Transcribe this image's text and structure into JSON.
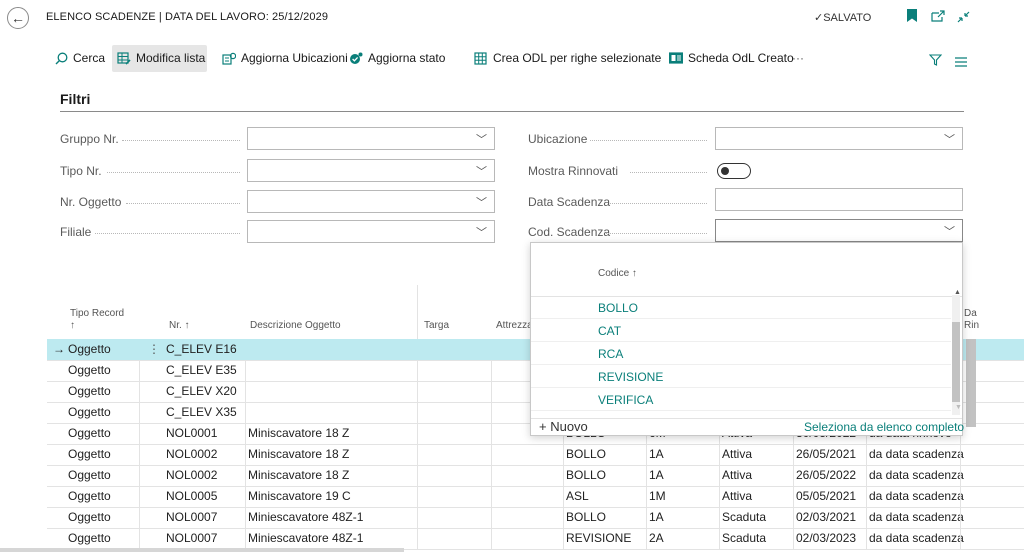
{
  "header": {
    "back_glyph": "←",
    "title": "ELENCO SCADENZE | DATA DEL LAVORO: 25/12/2029",
    "saved": "✓SALVATO"
  },
  "toolbar": {
    "search": "Cerca",
    "edit_list": "Modifica lista",
    "update_locations": "Aggiorna Ubicazioni",
    "update_status": "Aggiorna stato",
    "create_odl": "Crea ODL per righe selezionate",
    "odl_card": "Scheda OdL Creato",
    "more": "···"
  },
  "filters": {
    "heading": "Filtri",
    "gruppo_nr": "Gruppo Nr.",
    "tipo_nr": "Tipo Nr.",
    "nr_oggetto": "Nr. Oggetto",
    "filiale": "Filiale",
    "ubicazione": "Ubicazione",
    "mostra_rinnovati": "Mostra Rinnovati",
    "data_scadenza": "Data Scadenza",
    "cod_scadenza": "Cod. Scadenza"
  },
  "table": {
    "headers": {
      "tipo_record": "Tipo Record",
      "tipo_record_sort": "↑",
      "nr": "Nr. ↑",
      "descrizione": "Descrizione Oggetto",
      "targa": "Targa",
      "attrezza": "Attrezza",
      "da": "Da",
      "rin": "Rin"
    },
    "selected_arrow": "→",
    "rows": [
      {
        "tipo": "Oggetto",
        "nr": "C_ELEV E16",
        "desc": "",
        "cod": "",
        "per": "",
        "stato": "",
        "data": "",
        "calc": ""
      },
      {
        "tipo": "Oggetto",
        "nr": "C_ELEV E35",
        "desc": "",
        "cod": "",
        "per": "",
        "stato": "",
        "data": "",
        "calc": ""
      },
      {
        "tipo": "Oggetto",
        "nr": "C_ELEV X20",
        "desc": "",
        "cod": "",
        "per": "",
        "stato": "",
        "data": "",
        "calc": ""
      },
      {
        "tipo": "Oggetto",
        "nr": "C_ELEV X35",
        "desc": "",
        "cod": "",
        "per": "",
        "stato": "",
        "data": "",
        "calc": ""
      },
      {
        "tipo": "Oggetto",
        "nr": "NOL0001",
        "desc": "Miniscavatore 18 Z",
        "cod": "BOLLO",
        "per": "6M",
        "stato": "Attiva",
        "data": "30/05/2022",
        "calc": "da data rinnovo"
      },
      {
        "tipo": "Oggetto",
        "nr": "NOL0002",
        "desc": "Miniscavatore 18 Z",
        "cod": "BOLLO",
        "per": "1A",
        "stato": "Attiva",
        "data": "26/05/2021",
        "calc": "da data scadenza"
      },
      {
        "tipo": "Oggetto",
        "nr": "NOL0002",
        "desc": "Miniscavatore 18 Z",
        "cod": "BOLLO",
        "per": "1A",
        "stato": "Attiva",
        "data": "26/05/2022",
        "calc": "da data scadenza"
      },
      {
        "tipo": "Oggetto",
        "nr": "NOL0005",
        "desc": "Miniscavatore 19 C",
        "cod": "ASL",
        "per": "1M",
        "stato": "Attiva",
        "data": "05/05/2021",
        "calc": "da data scadenza"
      },
      {
        "tipo": "Oggetto",
        "nr": "NOL0007",
        "desc": "Miniescavatore 48Z-1",
        "cod": "BOLLO",
        "per": "1A",
        "stato": "Scaduta",
        "data": "02/03/2021",
        "calc": "da data scadenza"
      },
      {
        "tipo": "Oggetto",
        "nr": "NOL0007",
        "desc": "Miniescavatore 48Z-1",
        "cod": "REVISIONE",
        "per": "2A",
        "stato": "Scaduta",
        "data": "02/03/2023",
        "calc": "da data scadenza"
      }
    ]
  },
  "lookup": {
    "header": "Codice ↑",
    "items": [
      "BOLLO",
      "CAT",
      "RCA",
      "REVISIONE",
      "VERIFICA"
    ],
    "new_label": "+ Nuovo",
    "full_list": "Seleziona da elenco completo"
  },
  "colors": {
    "accent": "#0a7f7a",
    "selected_row": "#bdeaf0"
  }
}
